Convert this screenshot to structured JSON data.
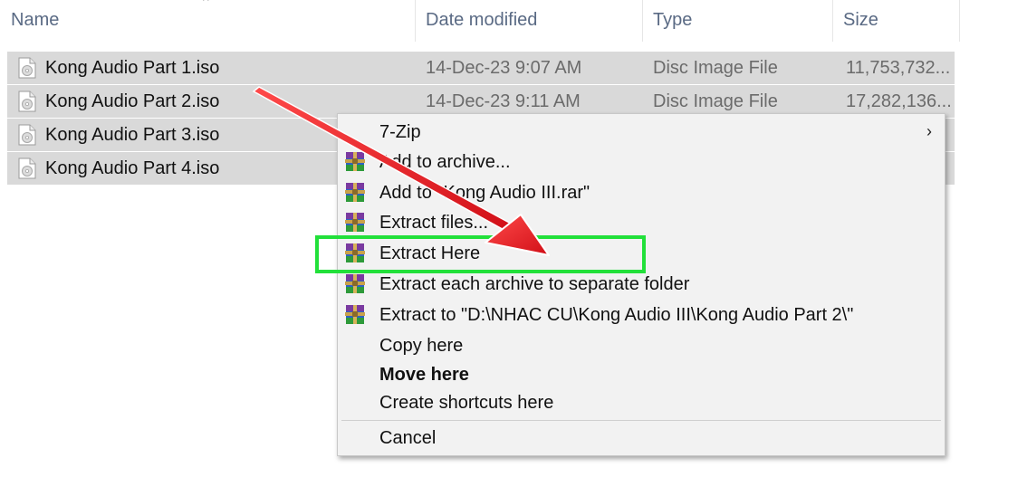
{
  "columns": {
    "name": "Name",
    "date": "Date modified",
    "type": "Type",
    "size": "Size"
  },
  "files": [
    {
      "name": "Kong Audio Part 1.iso",
      "date": "14-Dec-23 9:07 AM",
      "type": "Disc Image File",
      "size": "11,753,732..."
    },
    {
      "name": "Kong Audio Part 2.iso",
      "date": "14-Dec-23 9:11 AM",
      "type": "Disc Image File",
      "size": "17,282,136..."
    },
    {
      "name": "Kong Audio Part 3.iso",
      "date": "",
      "type": "",
      "size": ""
    },
    {
      "name": "Kong Audio Part 4.iso",
      "date": "",
      "type": "",
      "size": ""
    }
  ],
  "context_menu": {
    "items": [
      {
        "label": "7-Zip",
        "icon": "",
        "submenu": true
      },
      {
        "label": "Add to archive...",
        "icon": "winrar-icon"
      },
      {
        "label": "Add to \"Kong Audio III.rar\"",
        "icon": "winrar-icon"
      },
      {
        "label": "Extract files...",
        "icon": "winrar-icon"
      },
      {
        "label": "Extract Here",
        "icon": "winrar-icon",
        "highlighted": true
      },
      {
        "label": "Extract each archive to separate folder",
        "icon": "winrar-icon"
      },
      {
        "label": "Extract to \"D:\\NHAC CU\\Kong Audio III\\Kong Audio Part 2\\\"",
        "icon": "winrar-icon"
      },
      {
        "label": "Copy here",
        "icon": ""
      },
      {
        "label": "Move here",
        "icon": "",
        "bold": true
      },
      {
        "label": "Create shortcuts here",
        "icon": ""
      },
      {
        "label": "Cancel",
        "icon": ""
      }
    ],
    "submenu_chevron": "›"
  },
  "colors": {
    "selection": "#d9d9d9",
    "menu_bg": "#f2f2f2",
    "highlight_box": "#22e03a",
    "arrow": "#e8141e"
  }
}
